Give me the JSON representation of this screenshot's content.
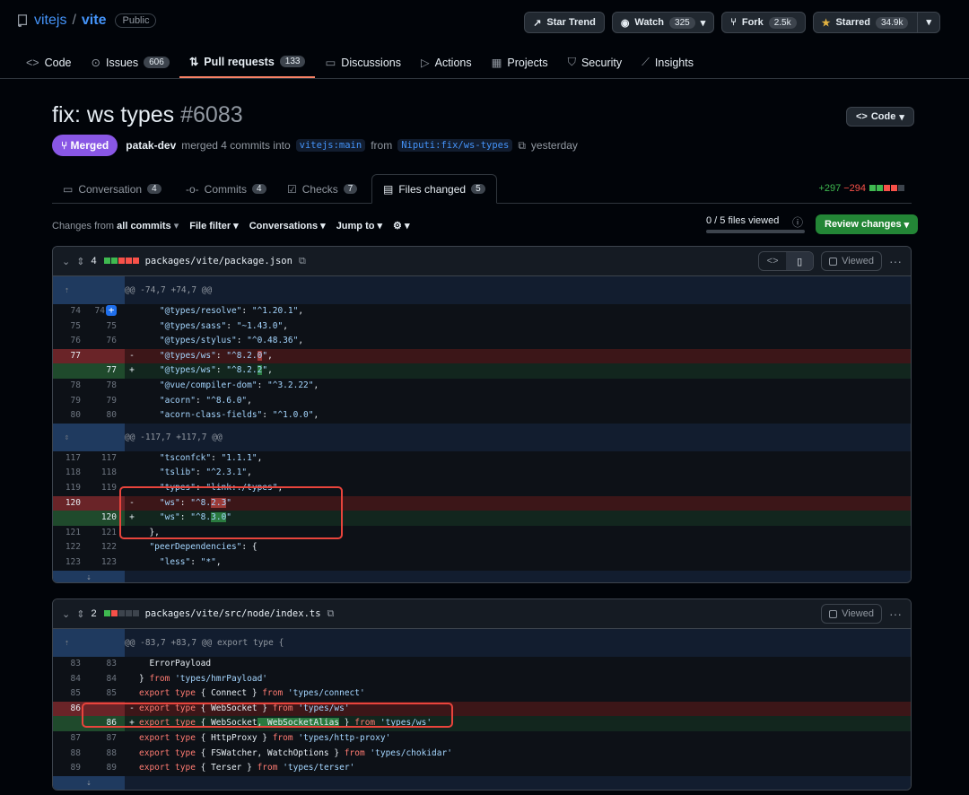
{
  "repo": {
    "owner": "vitejs",
    "sep": "/",
    "name": "vite",
    "visibility": "Public"
  },
  "header_buttons": [
    {
      "label": "Star Trend",
      "count": ""
    },
    {
      "label": "Watch",
      "count": "325"
    },
    {
      "label": "Fork",
      "count": "2.5k"
    },
    {
      "label": "Starred",
      "count": "34.9k"
    }
  ],
  "nav": [
    {
      "label": "Code",
      "count": ""
    },
    {
      "label": "Issues",
      "count": "606"
    },
    {
      "label": "Pull requests",
      "count": "133"
    },
    {
      "label": "Discussions",
      "count": ""
    },
    {
      "label": "Actions",
      "count": ""
    },
    {
      "label": "Projects",
      "count": ""
    },
    {
      "label": "Security",
      "count": ""
    },
    {
      "label": "Insights",
      "count": ""
    }
  ],
  "pr": {
    "title": "fix: ws types",
    "number": "#6083",
    "code_button": "Code",
    "status": "Merged",
    "author": "patak-dev",
    "merge_text": "merged 4 commits into",
    "base": "vitejs:main",
    "from": "from",
    "head": "Niputi:fix/ws-types",
    "when": "yesterday"
  },
  "tabs": [
    {
      "label": "Conversation",
      "count": "4"
    },
    {
      "label": "Commits",
      "count": "4"
    },
    {
      "label": "Checks",
      "count": "7"
    },
    {
      "label": "Files changed",
      "count": "5"
    }
  ],
  "diffstat": {
    "additions": "+297",
    "deletions": "−294"
  },
  "toolbar": {
    "changes_prefix": "Changes from",
    "changes_value": "all commits",
    "file_filter": "File filter",
    "conversations": "Conversations",
    "jump_to": "Jump to",
    "files_viewed": "0 / 5 files viewed",
    "review": "Review changes"
  },
  "files": [
    {
      "count": "4",
      "path": "packages/vite/package.json",
      "viewed": "Viewed",
      "hunks": [
        "@@ -74,7 +74,7 @@",
        "@@ -117,7 +117,7 @@"
      ]
    },
    {
      "count": "2",
      "path": "packages/vite/src/node/index.ts",
      "viewed": "Viewed",
      "hunks": [
        "@@ -83,7 +83,7 @@ export type {"
      ]
    }
  ],
  "colors": {
    "merged": "#8957e5",
    "accent": "#4493f8",
    "add": "#3fb950",
    "del": "#f85149",
    "review": "#238636"
  },
  "icons": {
    "repo": "repo-icon",
    "star_trend": "trend-icon",
    "watch": "eye-icon",
    "fork": "fork-icon",
    "starred": "star-icon",
    "copy": "copy-icon"
  }
}
